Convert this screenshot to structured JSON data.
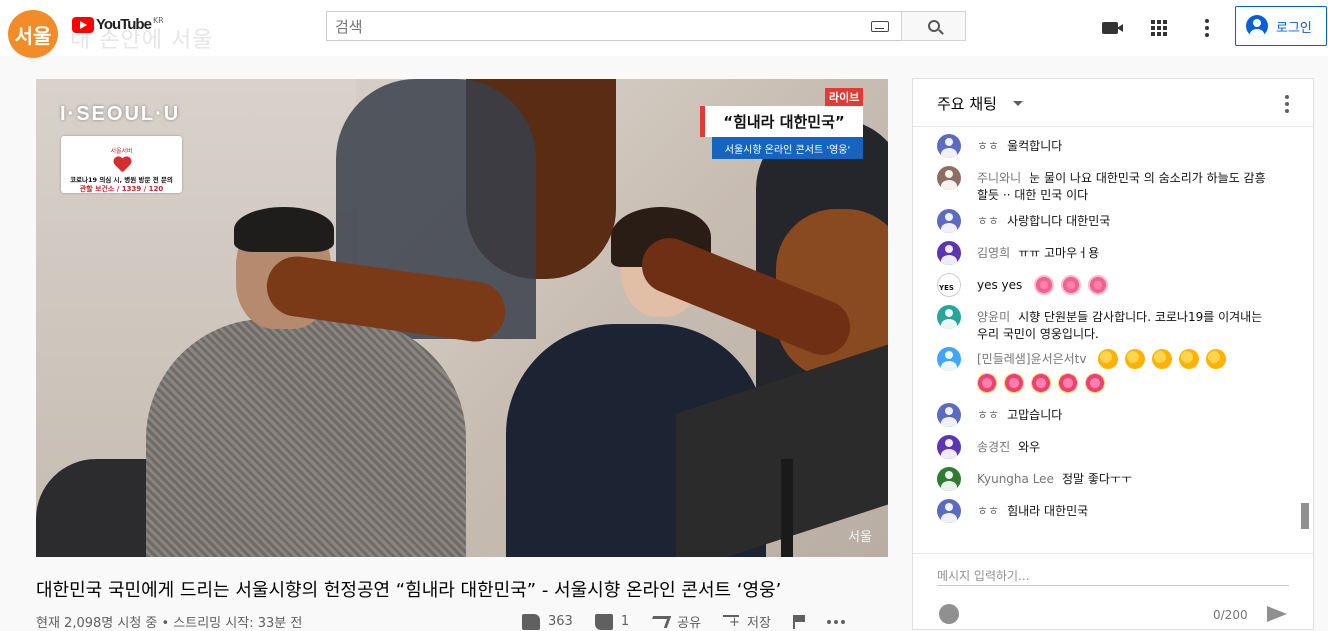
{
  "header": {
    "seoul_logo": "서울",
    "youtube_word": "YouTube",
    "youtube_region": "KR",
    "brand_text": "내 손안에 서울",
    "search_placeholder": "검색",
    "login_label": "로그인"
  },
  "video": {
    "iseoul_brand": "I·SEOUL·U",
    "notice_badge": "서울서버",
    "notice_line1": "코로나19 의심 시, 병원 방문 전 문의",
    "notice_line2": "관할 보건소 / 1339 / 120",
    "live_label": "라이브",
    "quote_text": "“힘내라 대한민국”",
    "concert_text": "서울시향 온라인 콘서트 '영웅'",
    "watermark": "서울"
  },
  "info": {
    "title": "대한민국 국민에게 드리는 서울시향의 헌정공연 “힘내라 대한민국” - 서울시향 온라인 콘서트 ‘영웅’",
    "meta": "현재 2,098명 시청 중 • 스트리밍 시작: 33분 전",
    "like_count": "363",
    "dislike_count": "1",
    "share_label": "공유",
    "save_label": "저장"
  },
  "chat": {
    "title": "주요 채팅",
    "input_placeholder": "메시지 입력하기...",
    "char_count": "0/200",
    "messages": [
      {
        "author": "ㅎㅎ",
        "text": "울컥합니다"
      },
      {
        "author": "주니와니",
        "text": "눈 물이 나요 대한민국 의 숨소리가 하늘도 감흥 할듯 ·· 대한 민국 이다"
      },
      {
        "author": "ㅎㅎ",
        "text": "사랑합니다 대한민국"
      },
      {
        "author": "김영희",
        "text": "ㅠㅠ 고마우ㅓ용"
      },
      {
        "author": "yes yes",
        "text": ""
      },
      {
        "author": "양윤미",
        "text": "시향 단원분들 감사합니다. 코로나19를 이겨내는 우리 국민이 영웅입니다."
      },
      {
        "author": "[민들레샘]윤서은서tv",
        "text": ""
      },
      {
        "author": "ㅎㅎ",
        "text": "고맙습니다"
      },
      {
        "author": "송경진",
        "text": "와우"
      },
      {
        "author": "Kyungha Lee",
        "text": "정말 좋다ㅜㅜ"
      },
      {
        "author": "ㅎㅎ",
        "text": "힘내라 대한민국"
      }
    ],
    "yes_avatar_text": "YES"
  }
}
